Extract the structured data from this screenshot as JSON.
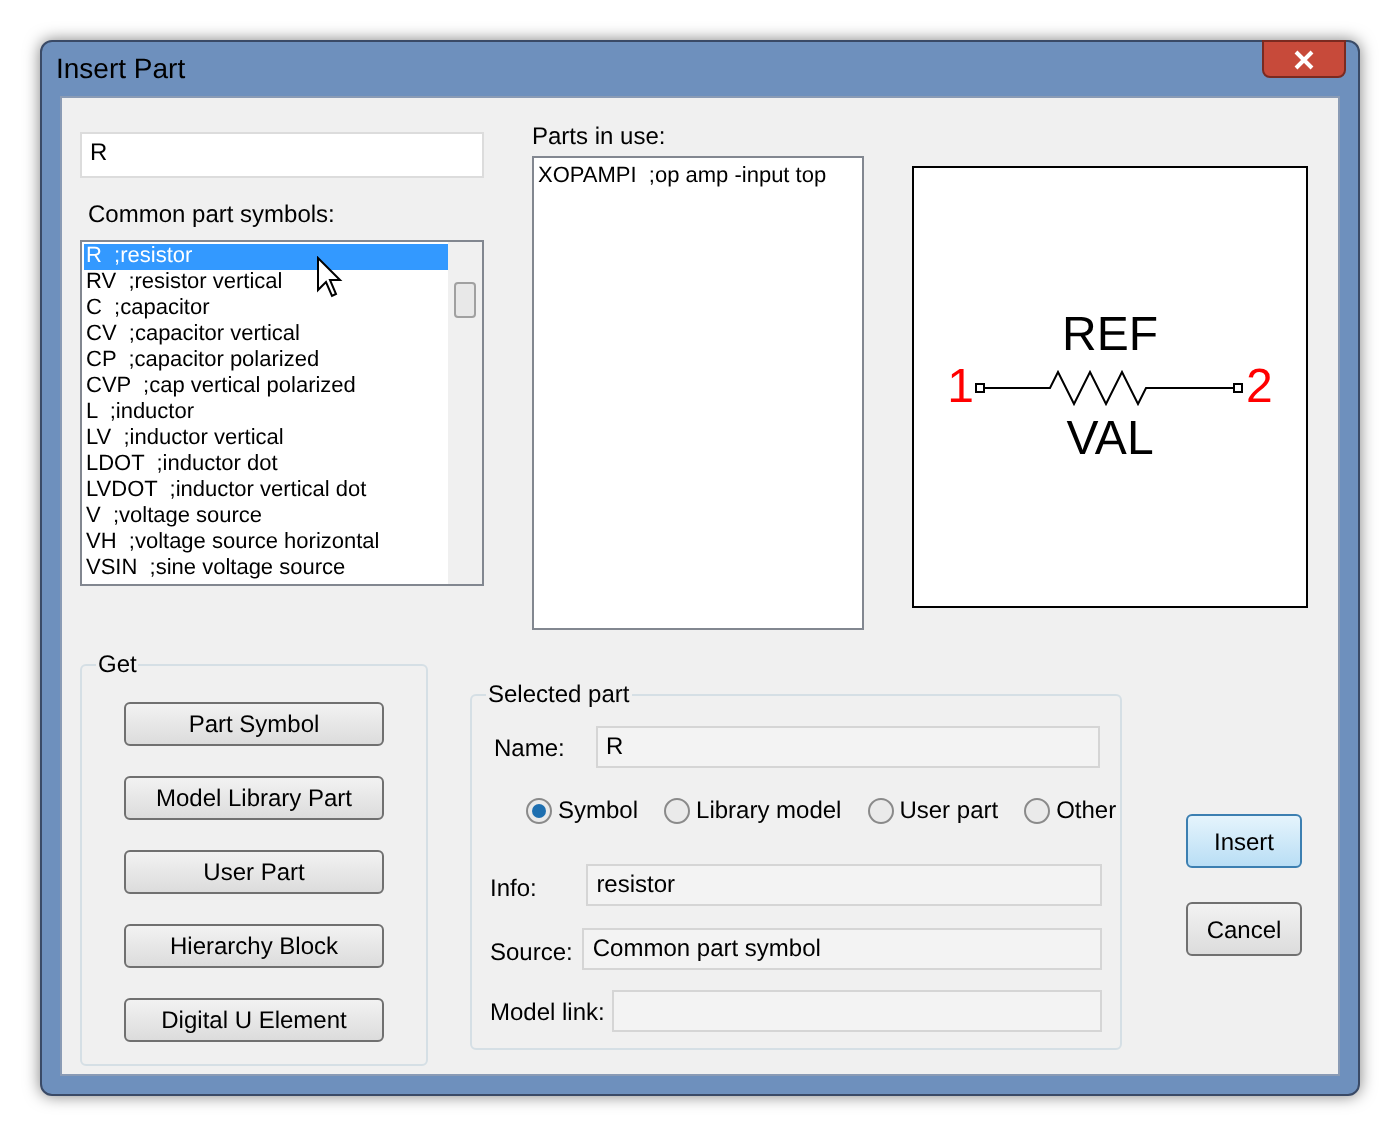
{
  "window": {
    "title": "Insert Part"
  },
  "search": {
    "value": "R"
  },
  "common_parts": {
    "label": "Common part symbols:",
    "items": [
      {
        "text": "R  ;resistor",
        "selected": true
      },
      {
        "text": "RV  ;resistor vertical",
        "selected": false
      },
      {
        "text": "C  ;capacitor",
        "selected": false
      },
      {
        "text": "CV  ;capacitor vertical",
        "selected": false
      },
      {
        "text": "CP  ;capacitor polarized",
        "selected": false
      },
      {
        "text": "CVP  ;cap vertical polarized",
        "selected": false
      },
      {
        "text": "L  ;inductor",
        "selected": false
      },
      {
        "text": "LV  ;inductor vertical",
        "selected": false
      },
      {
        "text": "LDOT  ;inductor dot",
        "selected": false
      },
      {
        "text": "LVDOT  ;inductor vertical dot",
        "selected": false
      },
      {
        "text": "V  ;voltage source",
        "selected": false
      },
      {
        "text": "VH  ;voltage source horizontal",
        "selected": false
      },
      {
        "text": "VSIN  ;sine voltage source",
        "selected": false
      }
    ]
  },
  "parts_in_use": {
    "label": "Parts in use:",
    "items": [
      {
        "text": "XOPAMPI  ;op amp -input top"
      }
    ]
  },
  "preview": {
    "ref": "REF",
    "val": "VAL",
    "pin_1": "1",
    "pin_2": "2"
  },
  "get_group": {
    "title": "Get",
    "buttons": [
      "Part Symbol",
      "Model Library Part",
      "User Part",
      "Hierarchy Block",
      "Digital U Element"
    ]
  },
  "selected_part": {
    "title": "Selected part",
    "name": {
      "label": "Name:",
      "value": "R"
    },
    "options": [
      {
        "label": "Symbol",
        "selected": true
      },
      {
        "label": "Library model",
        "selected": false
      },
      {
        "label": "User part",
        "selected": false
      },
      {
        "label": "Other",
        "selected": false
      }
    ],
    "info": {
      "label": "Info:",
      "value": "resistor"
    },
    "source": {
      "label": "Source:",
      "value": "Common part symbol"
    },
    "model_link": {
      "label": "Model link:"
    }
  },
  "buttons": [
    {
      "label": "Insert",
      "default": true
    },
    {
      "label": "Cancel",
      "default": false
    }
  ]
}
